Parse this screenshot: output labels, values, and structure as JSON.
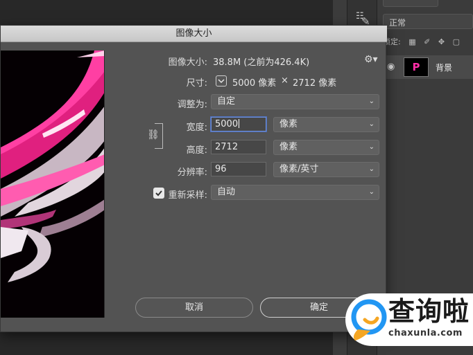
{
  "dialog": {
    "title": "图像大小",
    "image_size_label": "图像大小:",
    "image_size_value": "38.8M (之前为426.4K)",
    "dimensions_label": "尺寸:",
    "dimensions_width": "5000 像素",
    "dimensions_times": "×",
    "dimensions_height": "2712 像素",
    "fit_to_label": "调整为:",
    "fit_to_value": "自定",
    "width_label": "宽度:",
    "width_value": "5000",
    "width_unit": "像素",
    "height_label": "高度:",
    "height_value": "2712",
    "height_unit": "像素",
    "resolution_label": "分辨率:",
    "resolution_value": "96",
    "resolution_unit": "像素/英寸",
    "resample_label": "重新采样:",
    "resample_checked": true,
    "resample_value": "自动",
    "cancel_label": "取消",
    "ok_label": "确定"
  },
  "layers_panel": {
    "blend_mode": "正常",
    "lock_label": "锁定:",
    "layer_name": "背景",
    "layer_thumb_text": "P"
  },
  "watermark": {
    "chinese": "查询啦",
    "url": "chaxunla.com"
  },
  "colors": {
    "dialog_bg": "#535353",
    "accent_pink": "#ff2fa8",
    "focus_blue": "#6f8fd8"
  }
}
